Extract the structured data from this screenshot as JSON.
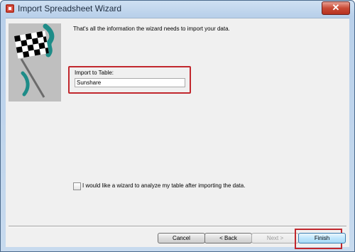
{
  "window": {
    "title": "Import Spreadsheet Wizard",
    "close_symbol": "✕"
  },
  "content": {
    "intro_text": "That's all the information the wizard needs to import your data.",
    "import_label": "Import to Table:",
    "table_name_value": "Sunshare",
    "analyze_checkbox_label": "I would like a wizard to analyze my table after importing the data.",
    "analyze_checked": false
  },
  "buttons": {
    "cancel": "Cancel",
    "back": "< Back",
    "next": "Next >",
    "finish": "Finish"
  },
  "colors": {
    "highlight": "#c1272d",
    "flag_accent": "#1e8c88"
  }
}
